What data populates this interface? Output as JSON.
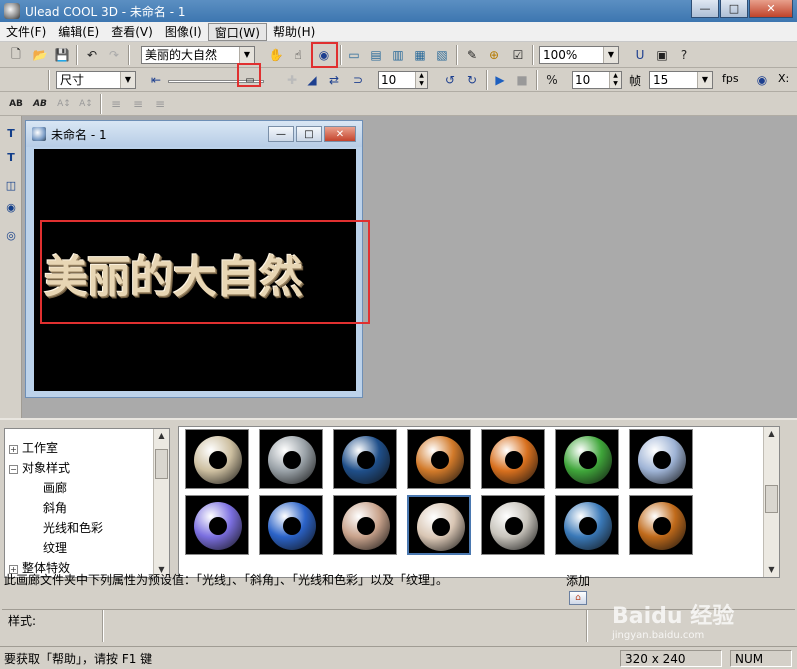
{
  "app": {
    "title": "Ulead COOL 3D - 未命名 - 1",
    "win_minimize": "—",
    "win_maximize": "□",
    "win_close": "✕"
  },
  "menu": [
    {
      "label": "文件(F)"
    },
    {
      "label": "编辑(E)"
    },
    {
      "label": "查看(V)"
    },
    {
      "label": "图像(I)"
    },
    {
      "label": "窗口(W)"
    },
    {
      "label": "帮助(H)"
    }
  ],
  "toolbar1": {
    "text_object_select": "美丽的大自然",
    "zoom_select": "100%"
  },
  "toolbar2": {
    "size_select": "尺寸",
    "rotate_value": "10",
    "frame_step_value": "10",
    "frame_label": "帧",
    "fps_select": "15",
    "fps_label": "fps",
    "x_label": "X:"
  },
  "document": {
    "title": "未命名 - 1",
    "text_art": "美丽的大自然",
    "btn_min": "—",
    "btn_max": "□",
    "btn_close": "✕"
  },
  "tree": {
    "items": [
      {
        "label": "工作室",
        "expander": "+"
      },
      {
        "label": "对象样式",
        "expander": "−"
      },
      {
        "label": "画廊"
      },
      {
        "label": "斜角"
      },
      {
        "label": "光线和色彩"
      },
      {
        "label": "纹理"
      },
      {
        "label": "整体特效",
        "expander": "+"
      }
    ]
  },
  "gallery": {
    "ring_colors": [
      "#cdbfa0",
      "#9aa2a8",
      "#1f4f8a",
      "#d27a2a",
      "#d8701e",
      "#3fa63a",
      "#9fb4d6",
      "#7b6fe0",
      "#2b63c8",
      "#c9a38c",
      "#d9c6b4",
      "#c8c4bc",
      "#3a79b8",
      "#c06a1a"
    ],
    "selected_index": 10
  },
  "description": "此画廊文件夹中下列属性为预设值：「光线」、「斜角」、「光线和色彩」以及「纹理」。",
  "add": {
    "label": "添加"
  },
  "style": {
    "label": "样式:"
  },
  "status": {
    "help": "要获取「帮助」，请按 F1 键",
    "size": "320 x 240",
    "num": "NUM"
  },
  "watermark": {
    "text": "Baidu 经验",
    "sub": "jingyan.baidu.com"
  }
}
